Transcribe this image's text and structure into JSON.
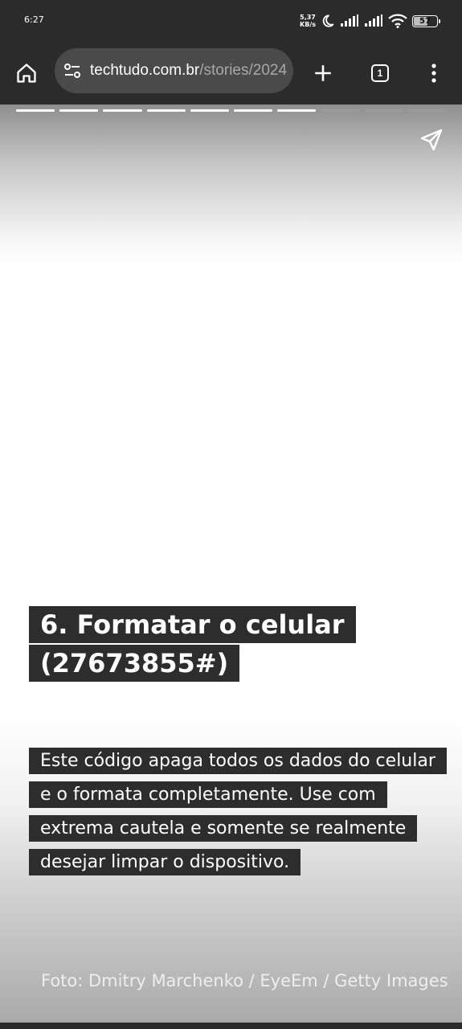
{
  "status_bar": {
    "time": "6:27",
    "net_speed_value": "5,37",
    "net_speed_unit": "KB/s",
    "battery_level": "57"
  },
  "browser": {
    "url_domain": "techtudo.com.br",
    "url_path": "/stories/2024",
    "tab_count": "1",
    "icons": [
      "home-icon",
      "site-settings-icon",
      "plus-icon",
      "tab-switcher-icon",
      "more-vert-icon"
    ]
  },
  "story": {
    "progress_segments": 10,
    "active_segments": 7,
    "title_lines": [
      "6. Formatar o celular",
      "(27673855#)"
    ],
    "description_lines": [
      "Este código apaga todos os dados do celular",
      "e o formata completamente. Use com",
      "extrema cautela e somente se realmente",
      "desejar limpar o dispositivo."
    ],
    "photo_credit": "Foto: Dmitry Marchenko / EyeEm / Getty Images"
  },
  "colors": {
    "chrome_bg": "#2b2b2b",
    "urlbar_bg": "#4a4a4a",
    "highlight_bg": "#2d2d2d",
    "progress_done": "#ffffff",
    "progress_todo": "#9a9a9a"
  }
}
